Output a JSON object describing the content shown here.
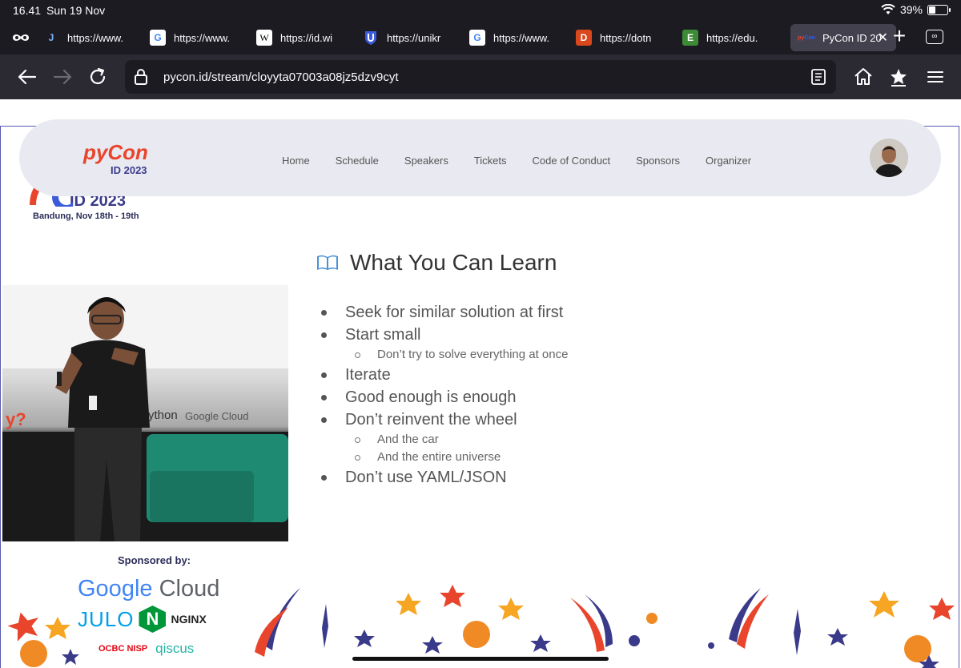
{
  "status": {
    "time": "16.41",
    "date": "Sun 19 Nov",
    "battery": "39%",
    "battery_level": 0.39
  },
  "tabs": [
    {
      "title": "https://www.",
      "favicon": "j-icon",
      "color": "#1a5fb4"
    },
    {
      "title": "https://www.",
      "favicon": "google-icon",
      "color": "#ffffff"
    },
    {
      "title": "https://id.wi",
      "favicon": "wikipedia-icon",
      "color": "#ffffff"
    },
    {
      "title": "https://unikr",
      "favicon": "shield-u-icon",
      "color": "#3b5bdb"
    },
    {
      "title": "https://www.",
      "favicon": "google-icon",
      "color": "#ffffff"
    },
    {
      "title": "https://dotn",
      "favicon": "d-icon",
      "color": "#d9481c"
    },
    {
      "title": "https://edu.",
      "favicon": "e-icon",
      "color": "#3d8b37"
    },
    {
      "title": "PyCon ID 20",
      "favicon": "pycon-icon",
      "color": "#42414d",
      "active": true
    }
  ],
  "tab_letters": {
    "wiki": "W",
    "dotnet": "D",
    "edu": "E",
    "j": "J",
    "google": "G"
  },
  "tabs_count": "∞",
  "url": "pycon.id/stream/cloyyta07003a08jz5dzv9cyt",
  "site_nav": [
    "Home",
    "Schedule",
    "Speakers",
    "Tickets",
    "Code of Conduct",
    "Sponsors",
    "Organizer"
  ],
  "logo": {
    "top": "pyCon",
    "bottom": "ID 2023"
  },
  "banner": {
    "year": "ID 2023",
    "location": "Bandung, Nov 18th - 19th"
  },
  "video_signage": {
    "python": "ython",
    "google_cloud": "Google Cloud",
    "pycon": "y?"
  },
  "slide": {
    "title": "What You Can Learn",
    "items": [
      {
        "text": "Seek for similar solution at first",
        "level": 1
      },
      {
        "text": "Start small",
        "level": 1
      },
      {
        "text": "Don’t try to solve everything at once",
        "level": 2
      },
      {
        "text": "Iterate",
        "level": 1
      },
      {
        "text": "Good enough is enough",
        "level": 1
      },
      {
        "text": "Don’t reinvent the wheel",
        "level": 1
      },
      {
        "text": "And the car",
        "level": 2
      },
      {
        "text": "And the entire universe",
        "level": 2
      },
      {
        "text": "Don’t use YAML/JSON",
        "level": 1
      }
    ]
  },
  "sponsors": {
    "title": "Sponsored by:",
    "google": "Google",
    "cloud": "Cloud",
    "julo": "JULO",
    "nginx": "NGINX",
    "nginx_letter": "N",
    "ocbc": "OCBC NISP",
    "qiscus": "qiscus"
  },
  "colors": {
    "chrome_bg": "#1c1b22",
    "nav_bg": "#2b2a33",
    "active_tab": "#42414d",
    "site_nav_bg": "#e9e9f1"
  }
}
